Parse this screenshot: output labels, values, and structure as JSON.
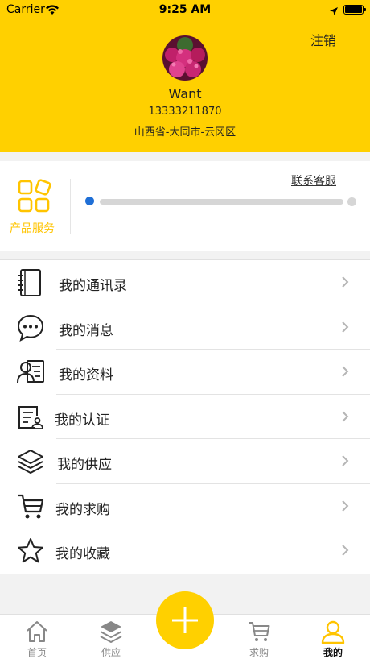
{
  "status_bar": {
    "carrier": "Carrier",
    "time": "9:25 AM"
  },
  "header": {
    "logout_label": "注销",
    "username": "Want",
    "phone": "13333211870",
    "address": "山西省-大同市-云冈区"
  },
  "service": {
    "label": "产品服务",
    "contact_label": "联系客服",
    "progress_fraction": 0.0
  },
  "menu": [
    {
      "label": "我的通讯录",
      "icon": "address-book-icon"
    },
    {
      "label": "我的消息",
      "icon": "chat-bubble-icon"
    },
    {
      "label": "我的资料",
      "icon": "profile-card-icon"
    },
    {
      "label": "我的认证",
      "icon": "certificate-icon"
    },
    {
      "label": "我的供应",
      "icon": "layers-icon"
    },
    {
      "label": "我的求购",
      "icon": "cart-icon"
    },
    {
      "label": "我的收藏",
      "icon": "star-icon"
    }
  ],
  "tabs": [
    {
      "label": "首页",
      "icon": "home-icon"
    },
    {
      "label": "供应",
      "icon": "layers-icon"
    },
    {
      "label": "求购",
      "icon": "cart-icon"
    },
    {
      "label": "我的",
      "icon": "user-icon"
    }
  ],
  "colors": {
    "accent": "#FFD000",
    "progress_dot": "#1F6FD6"
  }
}
